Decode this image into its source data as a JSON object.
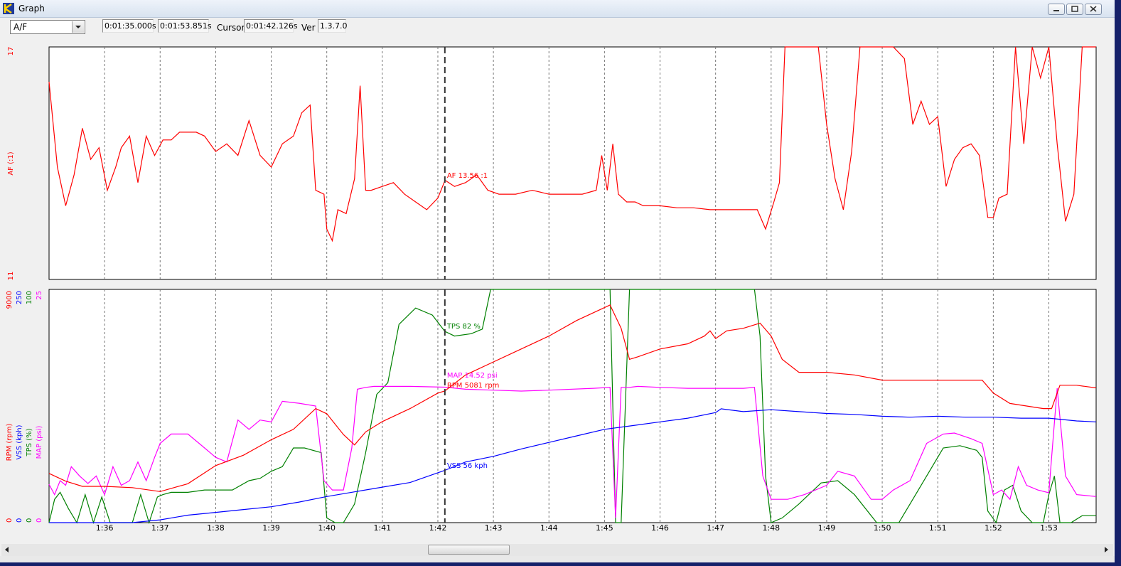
{
  "window": {
    "title": "Graph",
    "buttons": [
      "minimize-icon",
      "restore-icon",
      "close-icon"
    ]
  },
  "toolbar": {
    "channel": "A/F",
    "start_time": "0:01:35.000s",
    "end_time": "0:01:53.851s",
    "cursor_label": "Cursor",
    "cursor_time": "0:01:42.126s",
    "version_label": "Ver",
    "version": "1.3.7.0"
  },
  "chart_data": [
    {
      "type": "line",
      "name": "af-panel",
      "xlabel": "",
      "ylabel": "AF (:1)",
      "ylim": [
        11,
        17
      ],
      "xlim": [
        95.0,
        113.851
      ],
      "x_ticks": [
        "1:36",
        "1:37",
        "1:38",
        "1:39",
        "1:40",
        "1:41",
        "1:42",
        "1:43",
        "1:44",
        "1:45",
        "1:46",
        "1:47",
        "1:48",
        "1:49",
        "1:50",
        "1:51",
        "1:52",
        "1:53"
      ],
      "x_tick_values": [
        96,
        97,
        98,
        99,
        100,
        101,
        102,
        103,
        104,
        105,
        106,
        107,
        108,
        109,
        110,
        111,
        112,
        113
      ],
      "grid": "vertical dashed",
      "cursor_x": 102.126,
      "cursor_label": "AF 13.56 :1",
      "color": "#ff0000",
      "series": [
        {
          "x": [
            95.0,
            95.15,
            95.3,
            95.45,
            95.6,
            95.75,
            95.9,
            96.05,
            96.2,
            96.3,
            96.45,
            96.6,
            96.75,
            96.9,
            97.05,
            97.2,
            97.35,
            97.5,
            97.65,
            97.8,
            98.0,
            98.2,
            98.4,
            98.6,
            98.8,
            99.0,
            99.2,
            99.4,
            99.55,
            99.7,
            99.8,
            99.95,
            100.0,
            100.1,
            100.2,
            100.35,
            100.5,
            100.6,
            100.7,
            100.8,
            101.0,
            101.2,
            101.4,
            101.6,
            101.8,
            102.0,
            102.13,
            102.3,
            102.5,
            102.7,
            102.9,
            103.1,
            103.4,
            103.7,
            104.0,
            104.3,
            104.6,
            104.85,
            104.95,
            105.05,
            105.15,
            105.25,
            105.4,
            105.55,
            105.7,
            106.0,
            106.3,
            106.6,
            106.9,
            107.2,
            107.5,
            107.75,
            107.9,
            108.05,
            108.15,
            108.25,
            108.4,
            108.55,
            108.7,
            108.85,
            109.0,
            109.15,
            109.3,
            109.45,
            109.6,
            109.8,
            110.0,
            110.2,
            110.4,
            110.55,
            110.7,
            110.85,
            111.0,
            111.15,
            111.3,
            111.45,
            111.6,
            111.75,
            111.9,
            112.0,
            112.1,
            112.25,
            112.4,
            112.55,
            112.7,
            112.85,
            113.0,
            113.15,
            113.3,
            113.45,
            113.6,
            113.85
          ],
          "y": [
            16.1,
            13.9,
            12.9,
            13.7,
            14.9,
            14.1,
            14.4,
            13.3,
            13.9,
            14.4,
            14.7,
            13.5,
            14.7,
            14.2,
            14.6,
            14.6,
            14.8,
            14.8,
            14.8,
            14.7,
            14.3,
            14.5,
            14.2,
            15.1,
            14.2,
            13.9,
            14.5,
            14.7,
            15.3,
            15.5,
            13.3,
            13.2,
            12.3,
            12.0,
            12.8,
            12.7,
            13.6,
            16.0,
            13.3,
            13.3,
            13.4,
            13.5,
            13.2,
            13.0,
            12.8,
            13.1,
            13.56,
            13.4,
            13.5,
            13.7,
            13.3,
            13.2,
            13.2,
            13.3,
            13.2,
            13.2,
            13.2,
            13.3,
            14.2,
            13.3,
            14.5,
            13.2,
            13.0,
            13.0,
            12.9,
            12.9,
            12.85,
            12.85,
            12.8,
            12.8,
            12.8,
            12.8,
            12.3,
            13.0,
            13.5,
            17.0,
            17.0,
            17.0,
            17.0,
            17.0,
            15.0,
            13.6,
            12.8,
            14.3,
            17.0,
            17.0,
            17.0,
            17.0,
            16.7,
            15.0,
            15.6,
            15.0,
            15.2,
            13.4,
            14.1,
            14.4,
            14.5,
            14.2,
            12.6,
            12.6,
            13.1,
            13.2,
            17.0,
            14.5,
            17.0,
            16.2,
            17.0,
            14.5,
            12.5,
            13.2,
            17.0,
            17.0
          ]
        }
      ]
    },
    {
      "type": "line",
      "name": "multi-panel",
      "xlabel": "",
      "xlim": [
        95.0,
        113.851
      ],
      "x_ticks": [
        "1:36",
        "1:37",
        "1:38",
        "1:39",
        "1:40",
        "1:41",
        "1:42",
        "1:43",
        "1:44",
        "1:45",
        "1:46",
        "1:47",
        "1:48",
        "1:49",
        "1:50",
        "1:51",
        "1:52",
        "1:53"
      ],
      "x_tick_values": [
        96,
        97,
        98,
        99,
        100,
        101,
        102,
        103,
        104,
        105,
        106,
        107,
        108,
        109,
        110,
        111,
        112,
        113
      ],
      "grid": "vertical dashed",
      "cursor_x": 102.126,
      "axes": [
        {
          "ylabel": "RPM (rpm)",
          "ylim": [
            0,
            9000
          ],
          "color": "#ff0000"
        },
        {
          "ylabel": "VSS (kph)",
          "ylim": [
            0,
            250
          ],
          "color": "#0000ff"
        },
        {
          "ylabel": "TPS (%)",
          "ylim": [
            0,
            100
          ],
          "color": "#008000"
        },
        {
          "ylabel": "MAP (psi)",
          "ylim": [
            0,
            25
          ],
          "color": "#ff00ff"
        }
      ],
      "series": [
        {
          "axis": 0,
          "color": "#ff0000",
          "cursor_label": "RPM 5081 rpm",
          "x": [
            95.0,
            95.3,
            95.6,
            96.0,
            96.5,
            97.0,
            97.5,
            98.0,
            98.5,
            99.0,
            99.4,
            99.8,
            100.0,
            100.3,
            100.5,
            100.7,
            101.0,
            101.5,
            102.0,
            102.126,
            102.5,
            103.0,
            103.5,
            104.0,
            104.5,
            104.9,
            105.1,
            105.3,
            105.45,
            105.6,
            106.0,
            106.5,
            106.8,
            106.9,
            107.0,
            107.2,
            107.5,
            107.8,
            108.0,
            108.2,
            108.5,
            109.0,
            109.5,
            110.0,
            110.5,
            111.0,
            111.5,
            111.8,
            112.0,
            112.3,
            112.6,
            112.9,
            113.05,
            113.2,
            113.5,
            113.85
          ],
          "y": [
            1900,
            1600,
            1400,
            1400,
            1350,
            1200,
            1500,
            2200,
            2600,
            3200,
            3600,
            4400,
            4200,
            3400,
            3000,
            3500,
            3900,
            4400,
            5000,
            5081,
            5700,
            6200,
            6700,
            7200,
            7800,
            8200,
            8400,
            7500,
            6300,
            6400,
            6700,
            6900,
            7200,
            7400,
            7100,
            7400,
            7500,
            7700,
            7200,
            6300,
            5800,
            5800,
            5700,
            5500,
            5500,
            5500,
            5500,
            5500,
            5000,
            4600,
            4500,
            4400,
            4400,
            5300,
            5300,
            5200
          ]
        },
        {
          "axis": 1,
          "color": "#0000ff",
          "cursor_label": "VSS 56 kph",
          "x": [
            95.0,
            95.5,
            96.0,
            96.5,
            97.0,
            97.5,
            98.0,
            98.5,
            99.0,
            99.5,
            100.0,
            100.5,
            101.0,
            101.5,
            102.126,
            102.5,
            103.0,
            103.5,
            104.0,
            104.5,
            105.0,
            105.5,
            106.0,
            106.5,
            107.0,
            107.1,
            107.5,
            108.0,
            108.5,
            109.0,
            109.5,
            110.0,
            110.5,
            111.0,
            111.5,
            112.0,
            112.5,
            113.0,
            113.5,
            113.85
          ],
          "y": [
            0,
            0,
            0,
            0,
            3,
            8,
            11,
            14,
            17,
            22,
            28,
            33,
            38,
            43,
            56,
            65,
            71,
            79,
            86,
            93,
            100,
            104,
            108,
            112,
            118,
            122,
            119,
            121,
            119,
            117,
            116,
            114,
            113,
            114,
            113,
            113,
            112,
            112,
            109,
            108
          ]
        },
        {
          "axis": 2,
          "color": "#008000",
          "cursor_label": "TPS 82 %",
          "x": [
            95.0,
            95.1,
            95.2,
            95.35,
            95.5,
            95.65,
            95.8,
            95.95,
            96.1,
            96.3,
            96.5,
            96.65,
            96.8,
            96.95,
            97.05,
            97.2,
            97.5,
            97.8,
            98.0,
            98.3,
            98.6,
            98.8,
            99.0,
            99.2,
            99.4,
            99.6,
            99.9,
            100.0,
            100.15,
            100.3,
            100.5,
            100.7,
            100.9,
            101.1,
            101.3,
            101.6,
            101.9,
            102.126,
            102.3,
            102.6,
            102.8,
            102.95,
            103.2,
            104.0,
            104.8,
            105.1,
            105.2,
            105.3,
            105.45,
            105.6,
            106.0,
            107.0,
            107.5,
            107.7,
            107.8,
            107.9,
            108.0,
            108.2,
            108.5,
            108.9,
            109.2,
            109.5,
            109.9,
            110.1,
            110.3,
            110.5,
            110.8,
            111.1,
            111.4,
            111.7,
            111.8,
            111.9,
            112.05,
            112.2,
            112.35,
            112.5,
            112.7,
            112.9,
            113.0,
            113.1,
            113.2,
            113.4,
            113.6,
            113.85
          ],
          "y": [
            0,
            10,
            13,
            6,
            0,
            12,
            0,
            11,
            0,
            0,
            0,
            12,
            0,
            11,
            12,
            13,
            13,
            14,
            14,
            14,
            18,
            19,
            22,
            24,
            32,
            32,
            30,
            2,
            0,
            0,
            8,
            30,
            55,
            60,
            85,
            92,
            89,
            82,
            80,
            81,
            83,
            100,
            100,
            100,
            100,
            100,
            0,
            0,
            100,
            100,
            100,
            100,
            100,
            100,
            80,
            20,
            0,
            2,
            8,
            17,
            18,
            12,
            0,
            0,
            0,
            8,
            20,
            32,
            33,
            31,
            28,
            5,
            0,
            14,
            16,
            5,
            0,
            0,
            12,
            20,
            0,
            0,
            3,
            3
          ]
        },
        {
          "axis": 3,
          "color": "#ff00ff",
          "cursor_label": "MAP 14.52 psi",
          "x": [
            95.0,
            95.1,
            95.2,
            95.3,
            95.4,
            95.55,
            95.7,
            95.85,
            96.0,
            96.15,
            96.3,
            96.45,
            96.6,
            96.75,
            96.9,
            97.0,
            97.2,
            97.5,
            97.8,
            98.0,
            98.2,
            98.4,
            98.6,
            98.8,
            99.0,
            99.2,
            99.5,
            99.8,
            99.95,
            100.1,
            100.3,
            100.45,
            100.55,
            100.7,
            100.85,
            101.0,
            101.5,
            102.126,
            102.5,
            103.0,
            103.5,
            104.0,
            104.8,
            105.1,
            105.2,
            105.3,
            105.45,
            105.6,
            106.0,
            106.5,
            107.0,
            107.5,
            107.7,
            107.85,
            108.0,
            108.3,
            108.6,
            109.0,
            109.2,
            109.5,
            109.8,
            110.0,
            110.2,
            110.5,
            110.8,
            111.1,
            111.3,
            111.6,
            111.8,
            112.0,
            112.15,
            112.3,
            112.45,
            112.6,
            112.8,
            113.0,
            113.05,
            113.15,
            113.3,
            113.5,
            113.85
          ],
          "y": [
            4.1,
            3.0,
            4.5,
            4.0,
            6.0,
            5.0,
            4.2,
            5.0,
            3.0,
            6.0,
            4.0,
            4.5,
            6.5,
            4.5,
            7.0,
            8.5,
            9.5,
            9.5,
            8.0,
            7.0,
            6.5,
            11.0,
            10.0,
            11.0,
            10.8,
            13.0,
            12.8,
            12.5,
            4.5,
            3.5,
            3.5,
            8.0,
            14.3,
            14.5,
            14.6,
            14.6,
            14.6,
            14.52,
            14.3,
            14.2,
            14.1,
            14.2,
            14.4,
            14.5,
            0.5,
            14.5,
            14.5,
            14.6,
            14.5,
            14.4,
            14.4,
            14.4,
            14.5,
            5.0,
            2.5,
            2.5,
            3.0,
            4.0,
            5.5,
            5.0,
            2.5,
            2.5,
            3.5,
            4.5,
            8.5,
            9.5,
            9.6,
            9.0,
            8.5,
            3.0,
            3.5,
            2.5,
            6.0,
            4.0,
            3.5,
            3.2,
            7.0,
            14.4,
            5.0,
            3.0,
            2.8
          ]
        }
      ]
    }
  ]
}
